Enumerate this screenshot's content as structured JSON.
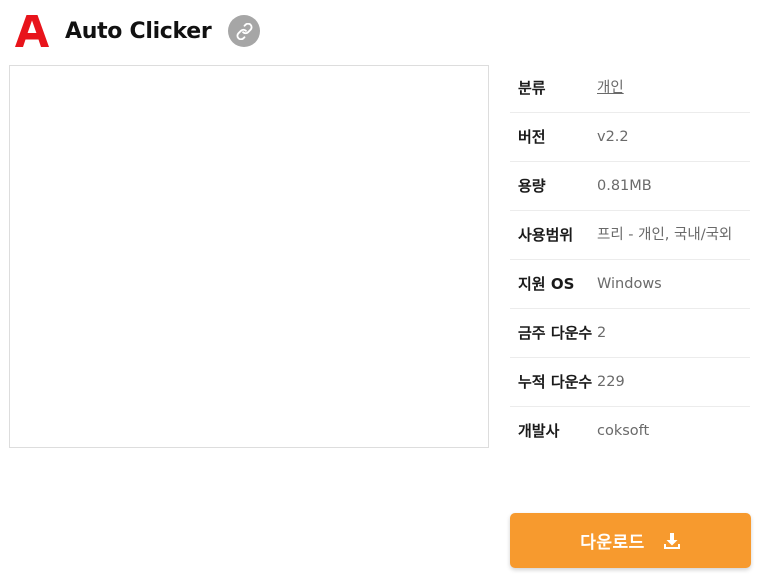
{
  "app": {
    "title": "Auto Clicker"
  },
  "colors": {
    "logo_red": "#e8141b",
    "link_button_bg": "#a6a6a6",
    "download_button_bg": "#f79a2e",
    "divider": "#ececec"
  },
  "icons": {
    "logo": "red-letter-a-icon",
    "share": "link-icon",
    "download": "download-arrow-icon"
  },
  "info": {
    "rows": [
      {
        "label": "분류",
        "value": "개인",
        "is_link": true
      },
      {
        "label": "버전",
        "value": "v2.2"
      },
      {
        "label": "용량",
        "value": "0.81MB"
      },
      {
        "label": "사용범위",
        "value": "프리 - 개인, 국내/국외"
      },
      {
        "label": "지원 OS",
        "value": "Windows"
      },
      {
        "label": "금주 다운수",
        "value": "2"
      },
      {
        "label": "누적 다운수",
        "value": "229"
      },
      {
        "label": "개발사",
        "value": "coksoft"
      }
    ]
  },
  "download": {
    "label": "다운로드"
  }
}
